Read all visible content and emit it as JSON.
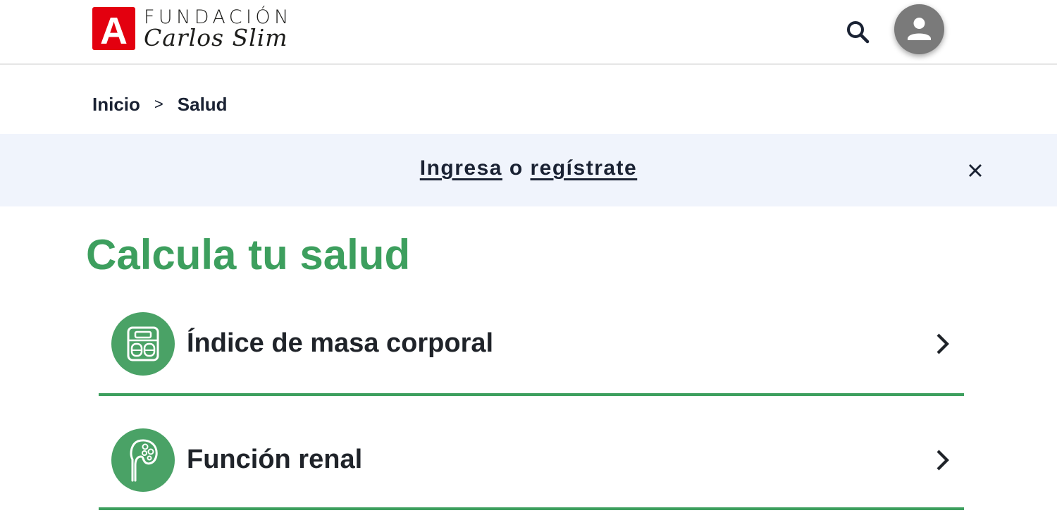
{
  "header": {
    "logo_top": "FUNDACIÓN",
    "logo_bottom": "Carlos Slim",
    "logo_letter": "A",
    "search_icon": "search-icon",
    "account_icon": "account-icon"
  },
  "breadcrumb": {
    "home": "Inicio",
    "separator": ">",
    "current": "Salud"
  },
  "banner": {
    "login": "Ingresa",
    "connector": "o",
    "register": "regístrate",
    "close_icon": "close-icon"
  },
  "main": {
    "title": "Calcula tu salud",
    "items": [
      {
        "label": "Índice de masa corporal",
        "icon": "scale-icon"
      },
      {
        "label": "Función renal",
        "icon": "kidney-icon"
      }
    ]
  },
  "colors": {
    "brand_green": "#3d9f5e",
    "logo_red": "#e3000f",
    "banner_bg": "#f0f4fc",
    "navy": "#1a2233"
  }
}
